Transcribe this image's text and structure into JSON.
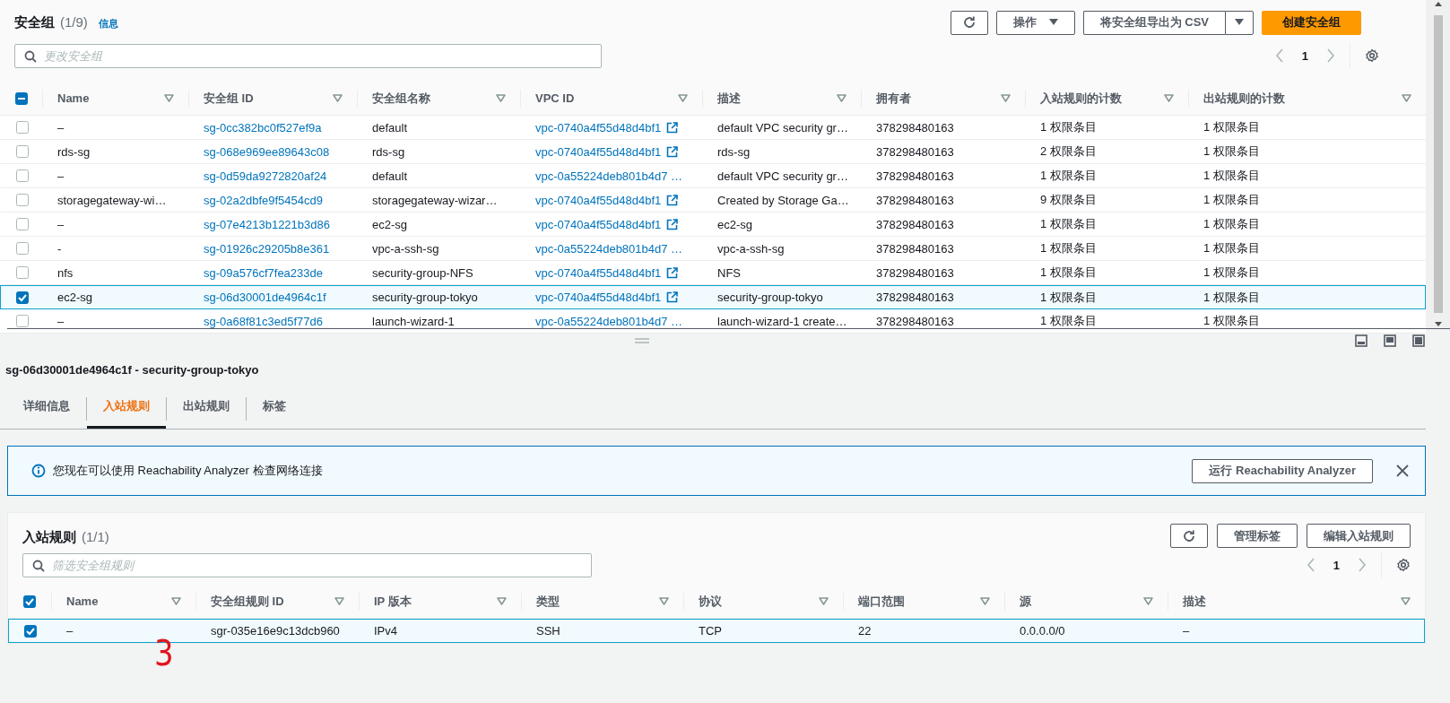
{
  "header": {
    "title": "安全组",
    "count": "(1/9)",
    "info_link": "信息"
  },
  "actions": [
    {
      "kind": "refresh"
    },
    {
      "kind": "dropdown",
      "label": "操作"
    },
    {
      "kind": "split",
      "label": "将安全组导出为 CSV"
    },
    {
      "kind": "primary",
      "label": "创建安全组"
    }
  ],
  "search": {
    "placeholder": "更改安全组"
  },
  "pagination": {
    "page": "1"
  },
  "table": {
    "select_all_checked": true,
    "select_all_partial": true,
    "columns": [
      {
        "label": "Name",
        "kind": "text"
      },
      {
        "label": "安全组 ID",
        "kind": "link"
      },
      {
        "label": "安全组名称",
        "kind": "text"
      },
      {
        "label": "VPC ID",
        "kind": "external"
      },
      {
        "label": "描述",
        "kind": "text"
      },
      {
        "label": "拥有者",
        "kind": "text"
      },
      {
        "label": "入站规则的计数",
        "kind": "text"
      },
      {
        "label": "出站规则的计数",
        "kind": "text"
      }
    ],
    "rows": [
      {
        "selected": false,
        "link_icon": true,
        "cells": [
          "–",
          "sg-0cc382bc0f527ef9a",
          "default",
          "vpc-0740a4f55d48d4bf1",
          "default VPC security gr…",
          "378298480163",
          "1 权限条目",
          "1 权限条目"
        ]
      },
      {
        "selected": false,
        "link_icon": true,
        "cells": [
          "rds-sg",
          "sg-068e969ee89643c08",
          "rds-sg",
          "vpc-0740a4f55d48d4bf1",
          "rds-sg",
          "378298480163",
          "2 权限条目",
          "1 权限条目"
        ]
      },
      {
        "selected": false,
        "link_icon": false,
        "cells": [
          "–",
          "sg-0d59da9272820af24",
          "default",
          "vpc-0a55224deb801b4d7 …",
          "default VPC security gr…",
          "378298480163",
          "1 权限条目",
          "1 权限条目"
        ]
      },
      {
        "selected": false,
        "link_icon": true,
        "cells": [
          "storagegateway-wi…",
          "sg-02a2dbfe9f5454cd9",
          "storagegateway-wizar…",
          "vpc-0740a4f55d48d4bf1",
          "Created by Storage Ga…",
          "378298480163",
          "9 权限条目",
          "1 权限条目"
        ]
      },
      {
        "selected": false,
        "link_icon": true,
        "cells": [
          "–",
          "sg-07e4213b1221b3d86",
          "ec2-sg",
          "vpc-0740a4f55d48d4bf1",
          "ec2-sg",
          "378298480163",
          "1 权限条目",
          "1 权限条目"
        ]
      },
      {
        "selected": false,
        "link_icon": false,
        "cells": [
          "-",
          "sg-01926c29205b8e361",
          "vpc-a-ssh-sg",
          "vpc-0a55224deb801b4d7 …",
          "vpc-a-ssh-sg",
          "378298480163",
          "1 权限条目",
          "1 权限条目"
        ]
      },
      {
        "selected": false,
        "link_icon": true,
        "cells": [
          "nfs",
          "sg-09a576cf7fea233de",
          "security-group-NFS",
          "vpc-0740a4f55d48d4bf1",
          "NFS",
          "378298480163",
          "1 权限条目",
          "1 权限条目"
        ]
      },
      {
        "selected": true,
        "link_icon": true,
        "cells": [
          "ec2-sg",
          "sg-06d30001de4964c1f",
          "security-group-tokyo",
          "vpc-0740a4f55d48d4bf1",
          "security-group-tokyo",
          "378298480163",
          "1 权限条目",
          "1 权限条目"
        ]
      },
      {
        "selected": false,
        "link_icon": false,
        "cells": [
          "–",
          "sg-0a68f81c3ed5f77d6",
          "launch-wizard-1",
          "vpc-0a55224deb801b4d7 …",
          "launch-wizard-1 create…",
          "378298480163",
          "1 权限条目",
          "1 权限条目"
        ]
      }
    ]
  },
  "details": {
    "title": "sg-06d30001de4964c1f - security-group-tokyo",
    "tabs": [
      {
        "label": "详细信息",
        "selected": false
      },
      {
        "label": "入站规则",
        "selected": true
      },
      {
        "label": "出站规则",
        "selected": false
      },
      {
        "label": "标签",
        "selected": false
      }
    ],
    "alert": {
      "text": "您现在可以使用 Reachability Analyzer 检查网络连接",
      "button": "运行 Reachability Analyzer"
    },
    "rules": {
      "title": "入站规则",
      "count": "(1/1)",
      "buttons": [
        "管理标签",
        "编辑入站规则"
      ],
      "search": {
        "placeholder": "筛选安全组规则"
      },
      "pagination": {
        "page": "1"
      },
      "table": {
        "select_all_checked": true,
        "select_all_partial": false,
        "columns": [
          {
            "label": "Name"
          },
          {
            "label": "安全组规则 ID"
          },
          {
            "label": "IP 版本"
          },
          {
            "label": "类型"
          },
          {
            "label": "协议"
          },
          {
            "label": "端口范围"
          },
          {
            "label": "源"
          },
          {
            "label": "描述"
          }
        ],
        "rows": [
          {
            "selected": true,
            "cells": [
              "–",
              "sgr-035e16e9c13dcb960",
              "IPv4",
              "SSH",
              "TCP",
              "22",
              "0.0.0.0/0",
              "–"
            ]
          }
        ]
      }
    },
    "annotation": "3"
  }
}
